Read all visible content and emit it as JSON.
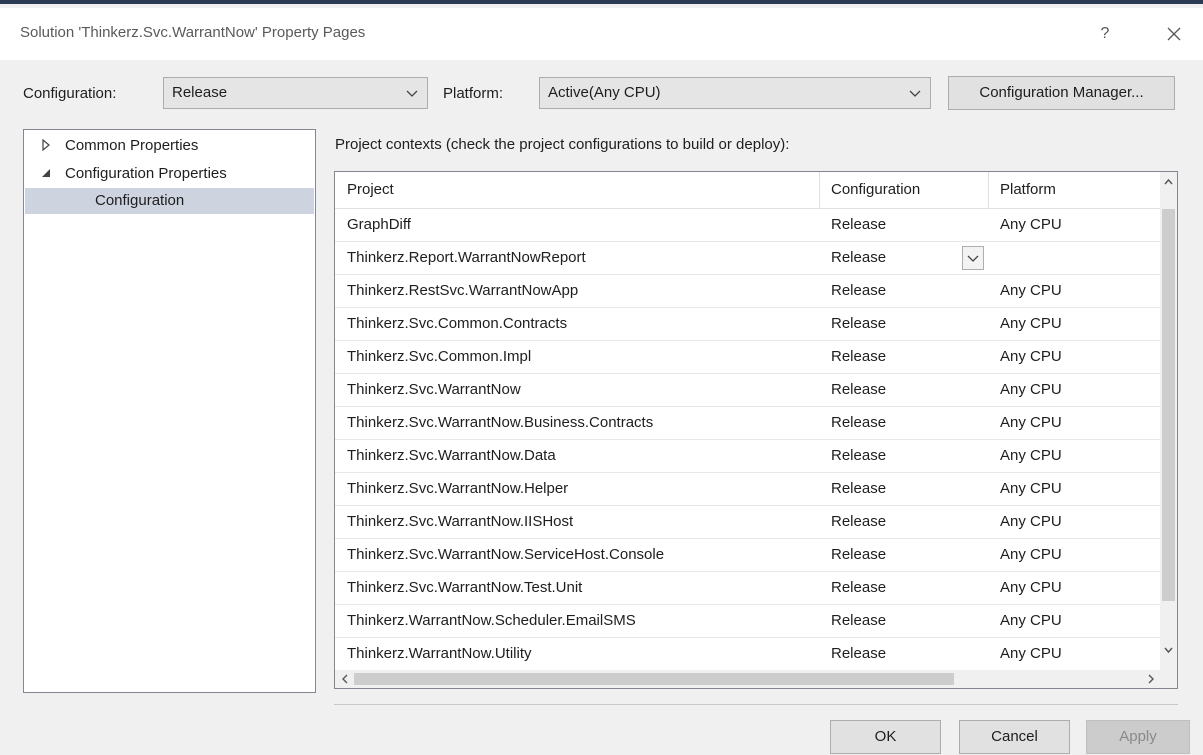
{
  "window": {
    "title": "Solution 'Thinkerz.Svc.WarrantNow' Property Pages",
    "help_label": "?"
  },
  "toolbar": {
    "configuration_label": "Configuration:",
    "configuration_value": "Release",
    "platform_label": "Platform:",
    "platform_value": "Active(Any CPU)",
    "config_manager_label": "Configuration Manager..."
  },
  "tree": {
    "items": [
      {
        "label": "Common Properties",
        "expanded": false
      },
      {
        "label": "Configuration Properties",
        "expanded": true
      },
      {
        "label": "Configuration",
        "selected": true
      }
    ]
  },
  "main": {
    "contexts_label": "Project contexts (check the project configurations to build or deploy):",
    "columns": [
      "Project",
      "Configuration",
      "Platform"
    ],
    "rows": [
      {
        "project": "GraphDiff",
        "configuration": "Release",
        "platform": "Any CPU"
      },
      {
        "project": "Thinkerz.Report.WarrantNowReport",
        "configuration": "Release",
        "platform": ""
      },
      {
        "project": "Thinkerz.RestSvc.WarrantNowApp",
        "configuration": "Release",
        "platform": "Any CPU"
      },
      {
        "project": "Thinkerz.Svc.Common.Contracts",
        "configuration": "Release",
        "platform": "Any CPU"
      },
      {
        "project": "Thinkerz.Svc.Common.Impl",
        "configuration": "Release",
        "platform": "Any CPU"
      },
      {
        "project": "Thinkerz.Svc.WarrantNow",
        "configuration": "Release",
        "platform": "Any CPU"
      },
      {
        "project": "Thinkerz.Svc.WarrantNow.Business.Contracts",
        "configuration": "Release",
        "platform": "Any CPU"
      },
      {
        "project": "Thinkerz.Svc.WarrantNow.Data",
        "configuration": "Release",
        "platform": "Any CPU"
      },
      {
        "project": "Thinkerz.Svc.WarrantNow.Helper",
        "configuration": "Release",
        "platform": "Any CPU"
      },
      {
        "project": "Thinkerz.Svc.WarrantNow.IISHost",
        "configuration": "Release",
        "platform": "Any CPU"
      },
      {
        "project": "Thinkerz.Svc.WarrantNow.ServiceHost.Console",
        "configuration": "Release",
        "platform": "Any CPU"
      },
      {
        "project": "Thinkerz.Svc.WarrantNow.Test.Unit",
        "configuration": "Release",
        "platform": "Any CPU"
      },
      {
        "project": "Thinkerz.WarrantNow.Scheduler.EmailSMS",
        "configuration": "Release",
        "platform": "Any CPU"
      },
      {
        "project": "Thinkerz.WarrantNow.Utility",
        "configuration": "Release",
        "platform": "Any CPU"
      }
    ]
  },
  "footer": {
    "ok_label": "OK",
    "cancel_label": "Cancel",
    "apply_label": "Apply"
  }
}
